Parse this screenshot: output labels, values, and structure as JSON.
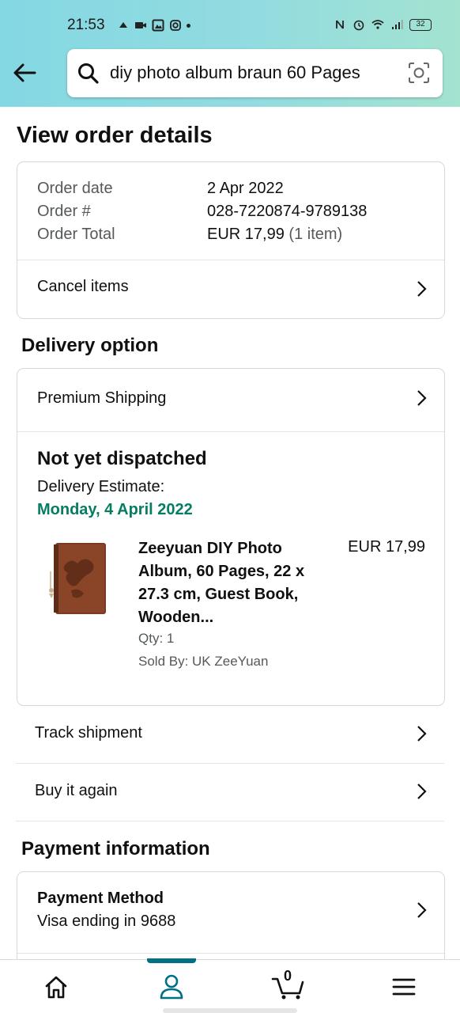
{
  "status_bar": {
    "time": "21:53",
    "battery": "32"
  },
  "search": {
    "query": "diy photo album braun 60 Pages"
  },
  "page": {
    "title": "View order details"
  },
  "order_summary": {
    "order_date_label": "Order date",
    "order_date_value": "2 Apr 2022",
    "order_number_label": "Order #",
    "order_number_value": "028-7220874-9789138",
    "order_total_label": "Order Total",
    "order_total_value": "EUR 17,99",
    "order_total_items": "(1 item)",
    "cancel_items_label": "Cancel items"
  },
  "delivery": {
    "section_title": "Delivery option",
    "shipping_label": "Premium Shipping",
    "status": "Not yet dispatched",
    "estimate_label": "Delivery Estimate:",
    "estimate_date": "Monday, 4 April 2022",
    "estimate_color": "#067d62"
  },
  "product": {
    "title": "Zeeyuan DIY Photo Album, 60 Pages, 22 x 27.3 cm, Guest Book, Wooden...",
    "price": "EUR 17,99",
    "qty": "Qty: 1",
    "seller": "Sold By: UK ZeeYuan"
  },
  "actions": {
    "track_label": "Track shipment",
    "buy_again_label": "Buy it again"
  },
  "payment": {
    "section_title": "Payment information",
    "method_title": "Payment Method",
    "method_detail": "Visa ending in 9688"
  },
  "bottom_nav": {
    "cart_count": "0",
    "active_tab": "account",
    "accent_color": "#007185"
  }
}
